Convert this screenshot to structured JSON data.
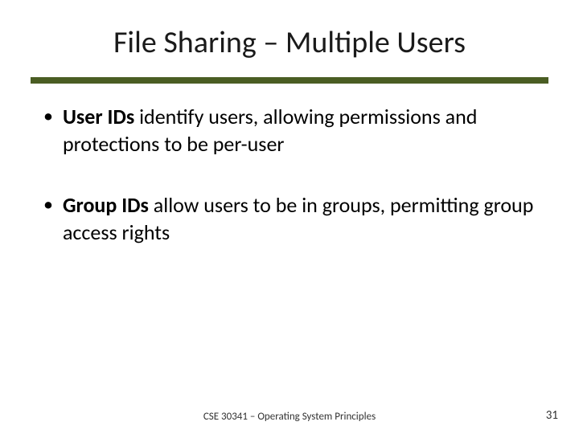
{
  "title": "File Sharing – Multiple Users",
  "bullets": [
    {
      "bold": "User IDs",
      "rest": " identify users, allowing permissions and protections to be per-user"
    },
    {
      "bold": "Group IDs",
      "rest": " allow users to be in groups, permitting group access rights"
    }
  ],
  "footer": {
    "center": "CSE 30341 – Operating System Principles",
    "page": "31"
  },
  "colors": {
    "rule": "#4a5d23"
  }
}
